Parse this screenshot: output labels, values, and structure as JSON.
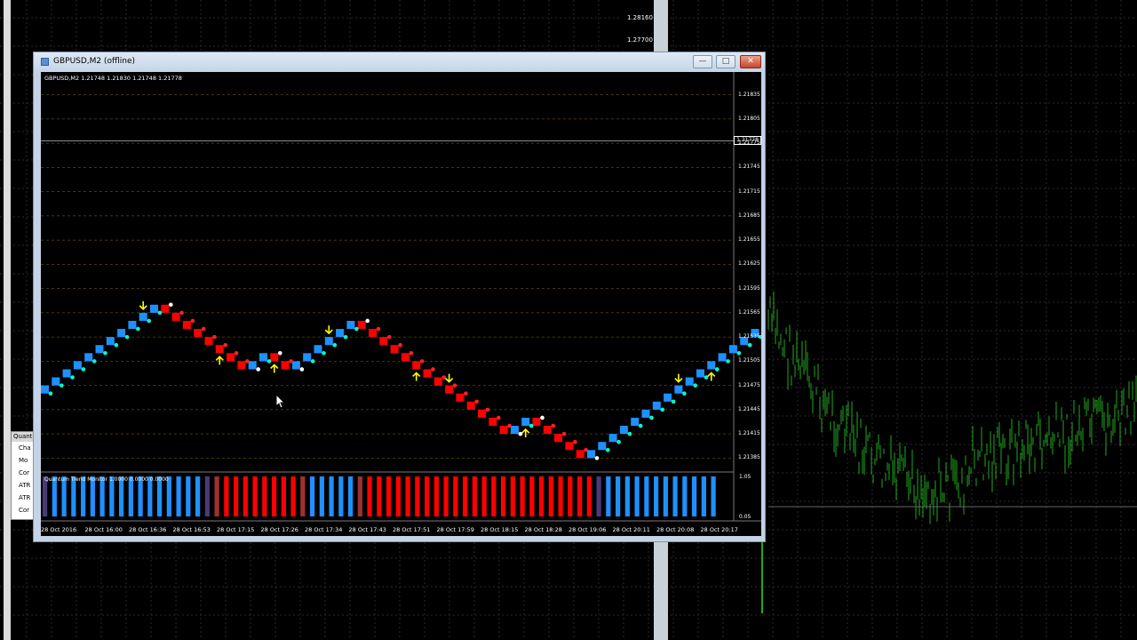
{
  "background": {
    "top_labels": [
      "1.28160",
      "1.27700"
    ]
  },
  "window": {
    "title": "GBPUSD,M2 (offline)",
    "symbol_info": "GBPUSD,M2  1.21748 1.21830 1.21748 1.21778",
    "current_price": "1.21778",
    "controls": {
      "minimize": "—",
      "maximize": "□",
      "close": "✕"
    },
    "y_axis": [
      "1.21835",
      "1.21805",
      "1.21775",
      "1.21745",
      "1.21715",
      "1.21685",
      "1.21655",
      "1.21625",
      "1.21595",
      "1.21565",
      "1.21535",
      "1.21505",
      "1.21475",
      "1.21445",
      "1.21415",
      "1.21385"
    ],
    "x_axis": [
      "28 Oct 2016",
      "28 Oct 16:00",
      "28 Oct 16:36",
      "28 Oct 16:53",
      "28 Oct 17:15",
      "28 Oct 17:26",
      "28 Oct 17:34",
      "28 Oct 17:43",
      "28 Oct 17:51",
      "28 Oct 17:59",
      "28 Oct 18:15",
      "28 Oct 18:28",
      "28 Oct 19:06",
      "28 Oct 20:11",
      "28 Oct 20:08",
      "28 Oct 20:17"
    ],
    "indicator": {
      "label": "Quantum Trend Monitor 1.0000 0.0000 0.0000",
      "max_label": "1.05",
      "min_label": "0.05",
      "colors": {
        "up": "#1e90ff",
        "down": "#ff0000",
        "neutral": "#4b3a78",
        "fading": "#a03030"
      },
      "sequence": [
        "N",
        "B",
        "B",
        "B",
        "B",
        "B",
        "B",
        "B",
        "B",
        "B",
        "B",
        "B",
        "B",
        "B",
        "B",
        "B",
        "B",
        "N",
        "F",
        "R",
        "R",
        "R",
        "R",
        "R",
        "R",
        "R",
        "R",
        "F",
        "B",
        "B",
        "B",
        "B",
        "B",
        "F",
        "R",
        "R",
        "R",
        "R",
        "R",
        "R",
        "R",
        "R",
        "R",
        "R",
        "R",
        "R",
        "R",
        "R",
        "R",
        "R",
        "R",
        "R",
        "R",
        "R",
        "R",
        "R",
        "R",
        "R",
        "N",
        "B",
        "B",
        "B",
        "B",
        "B",
        "B",
        "B",
        "B",
        "B",
        "B",
        "B",
        "B"
      ]
    }
  },
  "colors": {
    "bull": "#1e90ff",
    "bear": "#ff0000",
    "signal_arrow": "#ffff00",
    "dot_cyan": "#00ffcc",
    "dot_white": "#ffffff",
    "dot_red": "#ff2020",
    "grid": "#8b6914",
    "bg_candles": "#1fa81f"
  },
  "chart_data": {
    "type": "renko",
    "symbol": "GBPUSD",
    "timeframe": "M2",
    "brick_size": 0.0001,
    "start_level": 1.21465,
    "bricks": [
      "B",
      "B",
      "B",
      "B",
      "B",
      "B",
      "B",
      "B",
      "B",
      "B",
      "B",
      "R",
      "R",
      "R",
      "R",
      "R",
      "R",
      "R",
      "R",
      "B",
      "B",
      "R",
      "R",
      "B",
      "B",
      "B",
      "B",
      "B",
      "B",
      "R",
      "R",
      "R",
      "R",
      "R",
      "R",
      "R",
      "R",
      "R",
      "R",
      "R",
      "R",
      "R",
      "R",
      "B",
      "B",
      "R",
      "R",
      "R",
      "R",
      "R",
      "B",
      "B",
      "B",
      "B",
      "B",
      "B",
      "B",
      "B",
      "B",
      "B",
      "B",
      "B",
      "B",
      "B",
      "B",
      "B",
      "B",
      "R",
      "R",
      "R",
      "B",
      "B",
      "B"
    ],
    "sell_arrows": [
      9,
      26,
      37,
      58
    ],
    "buy_arrows": [
      16,
      21,
      34,
      44,
      61
    ]
  },
  "navigator": {
    "title": "Quant",
    "items": [
      "Cha",
      "Mo",
      "Cor",
      "ATR",
      "ATR",
      "Cor"
    ]
  },
  "cursor": "mouse-pointer"
}
